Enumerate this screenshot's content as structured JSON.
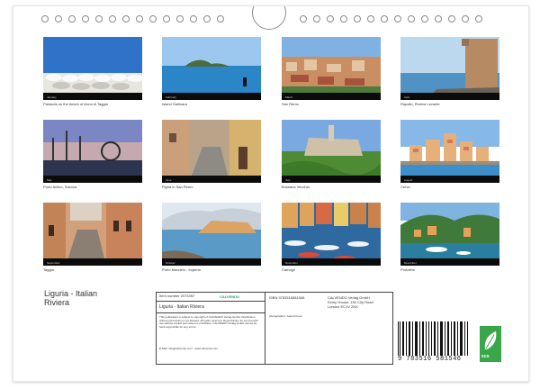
{
  "calendar": {
    "title_line1": "Liguria - Italian",
    "title_line2": "Riviera",
    "photos": [
      {
        "caption": "Parasols on the beach of Arma di Taggia",
        "tag": "January"
      },
      {
        "caption": "Island Gallinara",
        "tag": "February"
      },
      {
        "caption": "San Remo",
        "tag": "March"
      },
      {
        "caption": "Rapallo, Riviera Levante",
        "tag": "April"
      },
      {
        "caption": "Porto Antico, Savona",
        "tag": "May"
      },
      {
        "caption": "Pigna in San Remo",
        "tag": "June"
      },
      {
        "caption": "Bussana Vecchia",
        "tag": "July"
      },
      {
        "caption": "Cervo",
        "tag": "August"
      },
      {
        "caption": "Taggia",
        "tag": "September"
      },
      {
        "caption": "Porto Maurizio - Imperia",
        "tag": "October"
      },
      {
        "caption": "Camogli",
        "tag": "November"
      },
      {
        "caption": "Portofino",
        "tag": "December"
      }
    ]
  },
  "info": {
    "item_number": "Item number 2073397",
    "publisher_logo": "CALVENDO",
    "book_title": "Liguria - Italian Riviera",
    "notice": "This publication is subject to copyright of CALVENDO Verlag GmbH. Distribution without permission is not allowed. All rights reserved. Reproduction for commercial use without explicit permission is prohibited. CALVENDO Verlag GmbH cannot be held responsible for any errors.",
    "email": "E-Mail: info@calvendo.com · www.calvendo.com",
    "isbn": "ISBN 9783516581546",
    "photographer": "photographer: Joana Kruse",
    "publisher_name": "CALVENDO Verlag GmbH",
    "publisher_addr1": "Kemp House, 152 City Road",
    "publisher_addr2": "London EC1V 2NX",
    "barcode_text": "9 783516 581546",
    "eco_label": "eco"
  }
}
